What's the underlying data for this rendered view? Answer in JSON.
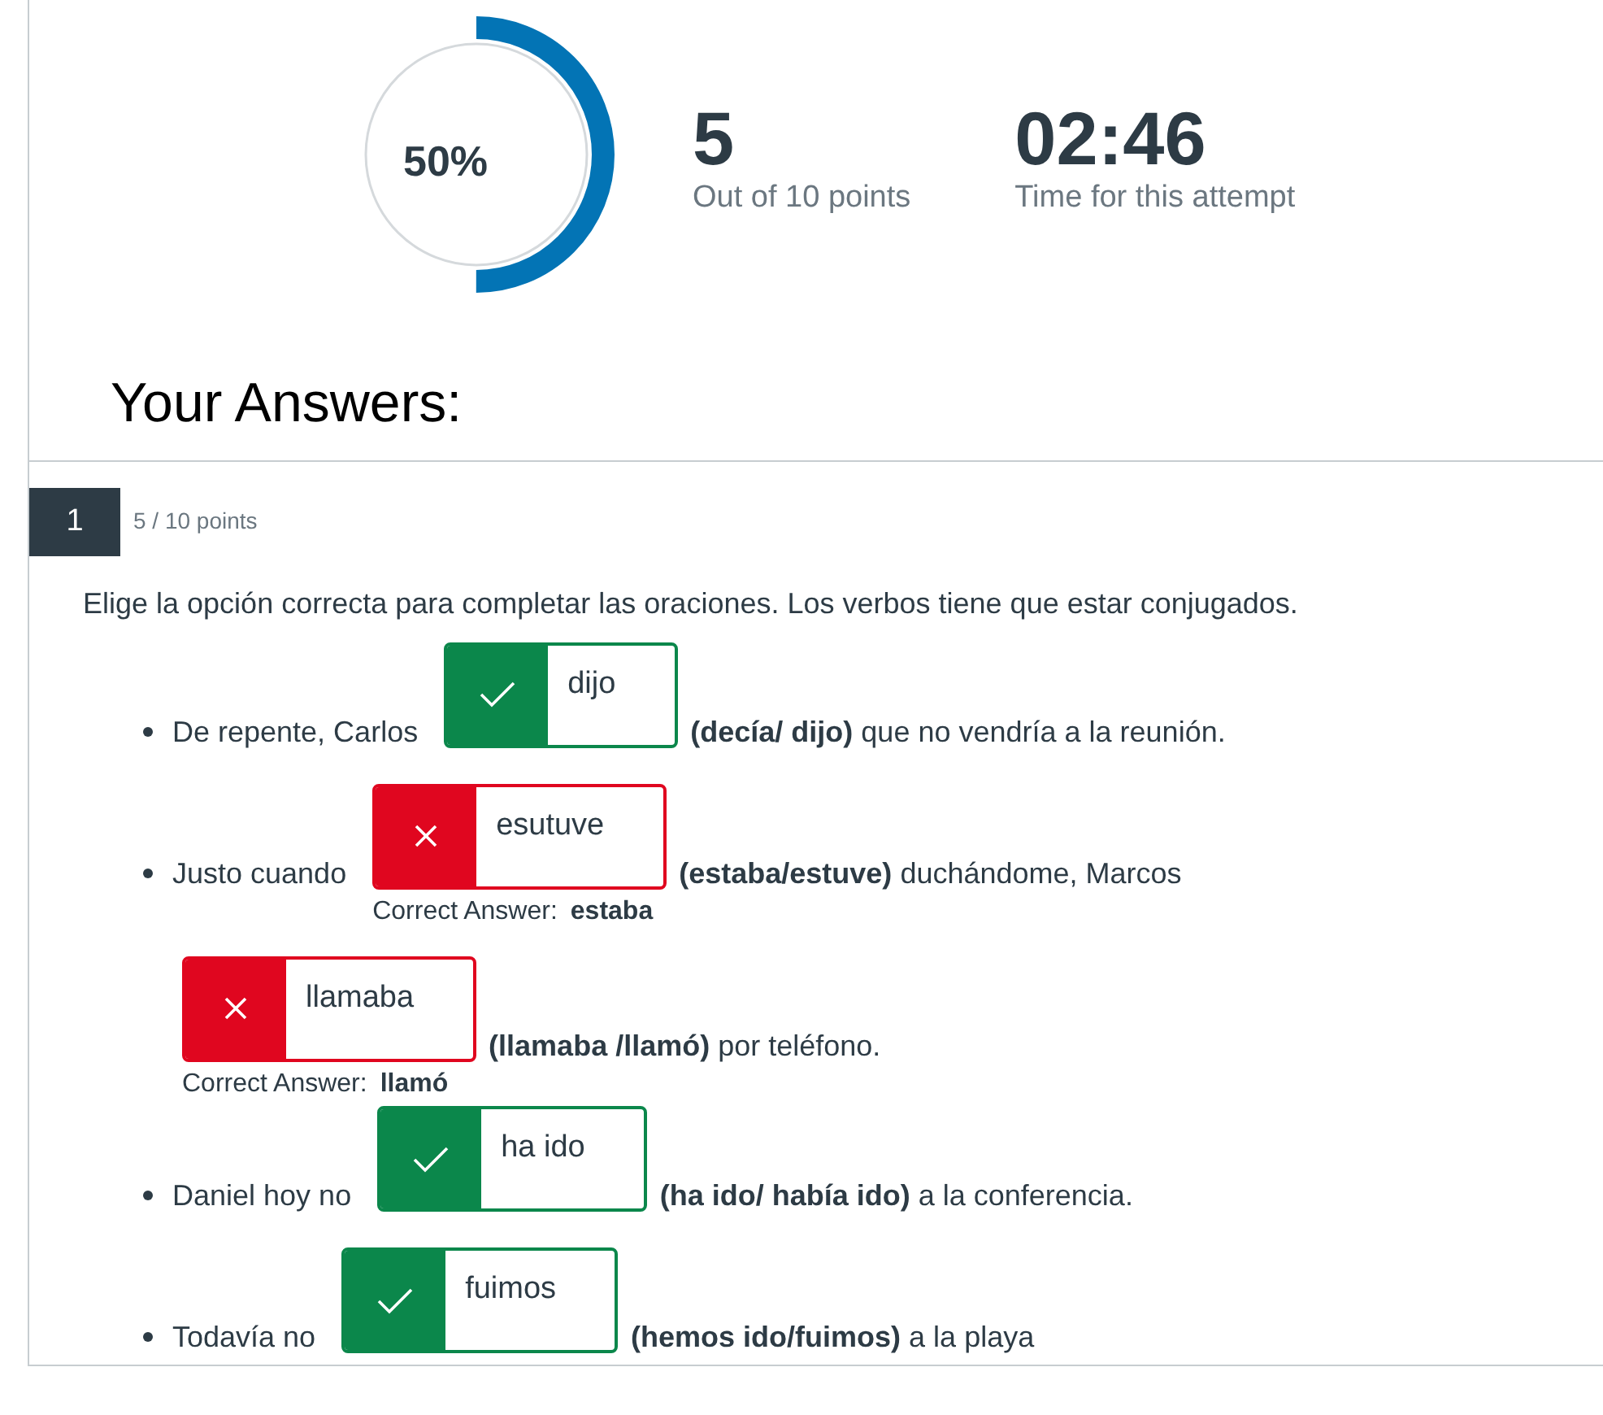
{
  "score": {
    "percent": "50%",
    "level": 0.5,
    "points": "5",
    "points_label": "Out of 10 points",
    "time": "02:46",
    "time_label": "Time for this attempt"
  },
  "heading": "Your Answers:",
  "question": {
    "number": "1",
    "points": "5 / 10 points",
    "prompt": "Elige la opción correcta para completar las oraciones. Los verbos tiene que estar conjugados.",
    "lines": [
      {
        "kind": "bullet",
        "before": "De repente, Carlos",
        "answer": {
          "value": "dijo",
          "correct": true
        },
        "after": "**(decía/ dijo)** que no vendría a la reunión."
      },
      {
        "kind": "bullet",
        "before": "Justo cuando",
        "answer": {
          "value": "esutuve",
          "correct": false,
          "correct_label": "Correct Answer:",
          "correct_answer": "estaba"
        },
        "after": "**(estaba/estuve)** duchándome, Marcos"
      },
      {
        "kind": "continuation",
        "answer": {
          "value": "llamaba",
          "correct": false,
          "correct_label": "Correct Answer:",
          "correct_answer": "llamó"
        },
        "after": "**(llamaba /llamó)** por teléfono."
      },
      {
        "kind": "bullet",
        "before": "Daniel hoy no",
        "answer": {
          "value": "ha ido",
          "correct": true
        },
        "after": "**(ha ido/ había ido)** a la conferencia."
      },
      {
        "kind": "bullet",
        "before": "Todavía no",
        "answer": {
          "value": "fuimos",
          "correct": true
        },
        "after": "**(hemos ido/fuimos)** a la playa"
      }
    ]
  }
}
